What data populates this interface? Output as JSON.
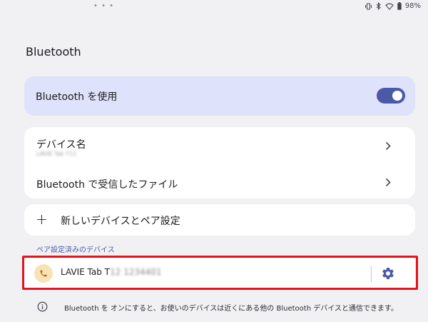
{
  "status_bar": {
    "dots": "• • •",
    "battery": "98%",
    "icons": [
      "vibrate-icon",
      "bluetooth-icon",
      "wifi-icon",
      "battery-icon"
    ]
  },
  "page_title": "Bluetooth",
  "use_bluetooth": {
    "label": "Bluetooth を使用",
    "enabled": true
  },
  "device_name": {
    "title": "デバイス名",
    "value": "LAVIE Tab T11"
  },
  "received_files": {
    "title": "Bluetooth で受信したファイル"
  },
  "add_device": {
    "label": "新しいデバイスとペア設定"
  },
  "paired_section": {
    "label": "ペア設定済みのデバイス"
  },
  "paired_device": {
    "name_visible": "LAVIE Tab T",
    "name_obscured": "12 1234401"
  },
  "info_text": "Bluetooth を オンにすると、お使いのデバイスは近くにある他の Bluetooth デバイスと通信できます。",
  "colors": {
    "accent": "#4a5aa8",
    "toggle_track": "#4a5aa8",
    "highlight": "#e2141e",
    "phone_circle": "#f8e3b7"
  }
}
